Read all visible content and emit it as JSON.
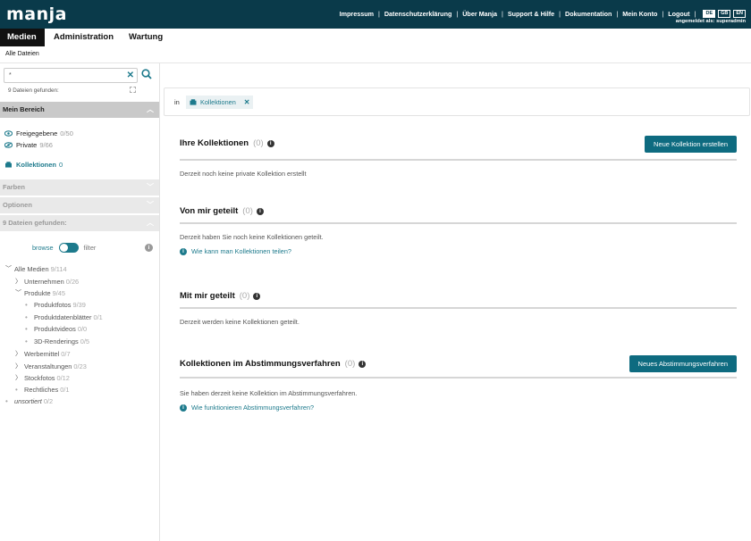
{
  "header": {
    "logo": "manja",
    "nav": [
      "Impressum",
      "Datenschutzerklärung",
      "Über Manja",
      "Support & Hilfe",
      "Dokumentation",
      "Mein Konto",
      "Logout"
    ],
    "languages": [
      "DE",
      "GB",
      "EN"
    ],
    "logged_in": "angemeldet als: superadmin"
  },
  "mainnav": {
    "tabs": [
      "Medien",
      "Administration",
      "Wartung"
    ],
    "sub": "Alle Dateien"
  },
  "sidebar": {
    "search_value": "*",
    "found_small": "9 Dateien gefunden:",
    "mein_bereich": "Mein Bereich",
    "freigegebene": {
      "label": "Freigegebene",
      "count": "0/50"
    },
    "private": {
      "label": "Private",
      "count": "9/66"
    },
    "kollektionen": {
      "label": "Kollektionen",
      "count": "0"
    },
    "farben": "Farben",
    "optionen": "Optionen",
    "found_head": "9 Dateien gefunden:",
    "browse": "browse",
    "filter": "filter",
    "tree": [
      {
        "label": "Alle Medien",
        "count": "9/114"
      },
      {
        "label": "Unternehmen",
        "count": "0/26"
      },
      {
        "label": "Produkte",
        "count": "9/45"
      },
      {
        "label": "Produktfotos",
        "count": "9/39"
      },
      {
        "label": "Produktdatenblätter",
        "count": "0/1"
      },
      {
        "label": "Produktvideos",
        "count": "0/0"
      },
      {
        "label": "3D-Renderings",
        "count": "0/5"
      },
      {
        "label": "Werbemittel",
        "count": "0/7"
      },
      {
        "label": "Veranstaltungen",
        "count": "0/23"
      },
      {
        "label": "Stockfotos",
        "count": "0/12"
      },
      {
        "label": "Rechtliches",
        "count": "0/1"
      },
      {
        "label": "unsortiert",
        "count": "0/2"
      }
    ]
  },
  "filterbar": {
    "in": "in",
    "chip": "Kollektionen"
  },
  "sections": {
    "ihre": {
      "title": "Ihre Kollektionen",
      "count": "(0)",
      "msg": "Derzeit noch keine private Kollektion erstellt",
      "button": "Neue Kollektion erstellen"
    },
    "von": {
      "title": "Von mir geteilt",
      "count": "(0)",
      "msg": "Derzeit haben Sie noch keine Kollektionen geteilt.",
      "link": "Wie kann man Kollektionen teilen?"
    },
    "mit": {
      "title": "Mit mir geteilt",
      "count": "(0)",
      "msg": "Derzeit werden keine Kollektionen geteilt."
    },
    "abst": {
      "title": "Kollektionen im Abstimmungsverfahren",
      "count": "(0)",
      "msg": "Sie haben derzeit keine Kollektion im Abstimmungsverfahren.",
      "link": "Wie funktionieren Abstimmungsverfahren?",
      "button": "Neues Abstimmungsverfahren"
    }
  },
  "colors": {
    "header_bg": "#0a3a4a",
    "accent": "#1d7a8c",
    "button": "#0e6b80"
  }
}
